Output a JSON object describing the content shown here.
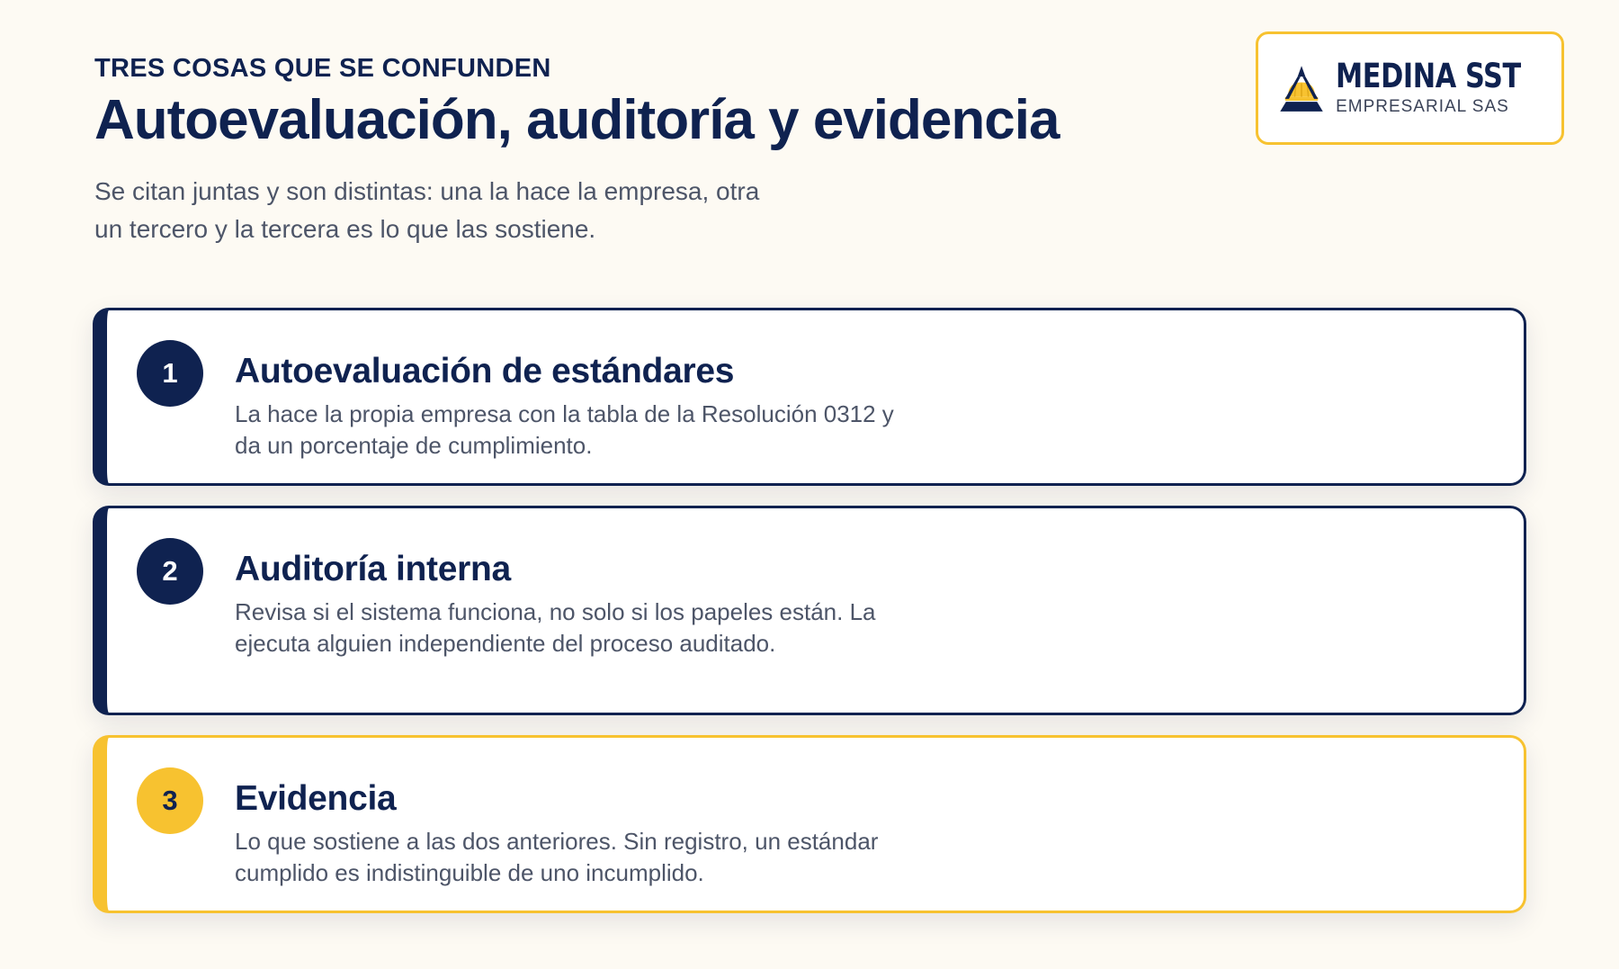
{
  "header": {
    "eyebrow": "TRES COSAS QUE SE CONFUNDEN",
    "title": "Autoevaluación, auditoría y evidencia",
    "subtitle": "Se citan juntas y son distintas: una la hace la empresa, otra un tercero y la tercera es lo que las sostiene."
  },
  "logo": {
    "name": "MEDINA SST",
    "sub": "EMPRESARIAL SAS",
    "icon": "hard-hat-icon"
  },
  "cards": [
    {
      "number": "1",
      "title": "Autoevaluación de estándares",
      "text": "La hace la propia empresa con la tabla de la Resolución 0312 y da un porcentaje de cumplimiento."
    },
    {
      "number": "2",
      "title": "Auditoría interna",
      "text": "Revisa si el sistema funciona, no solo si los papeles están. La ejecuta alguien independiente del proceso auditado."
    },
    {
      "number": "3",
      "title": "Evidencia",
      "text": "Lo que sostiene a las dos anteriores. Sin registro, un estándar cumplido es indistinguible de uno incumplido."
    }
  ],
  "colors": {
    "navy": "#0f2250",
    "gold": "#f7c230",
    "background": "#fdfaf3",
    "muted_text": "#4d5568"
  }
}
